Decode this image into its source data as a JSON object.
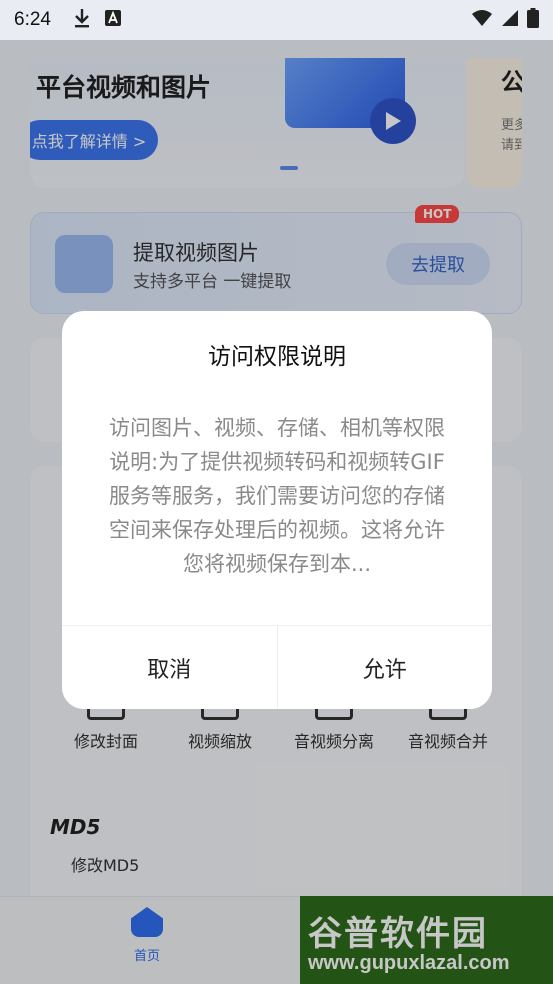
{
  "status_bar": {
    "time": "6:24"
  },
  "banner": {
    "title": "平台视频和图片",
    "button": "点我了解详情 >"
  },
  "side_card": {
    "title": "公",
    "text": "更多 请到"
  },
  "extract": {
    "title": "提取视频图片",
    "subtitle": "支持多平台 一键提取",
    "button": "去提取",
    "badge": "HOT"
  },
  "tools": [
    {
      "label": "修改封面"
    },
    {
      "label": "视频缩放"
    },
    {
      "label": "音视频分离"
    },
    {
      "label": "音视频合并"
    }
  ],
  "md5": {
    "icon_text": "MD5",
    "label": "修改MD5"
  },
  "bottom_nav": {
    "home_label": "首页"
  },
  "watermark": {
    "title": "谷普软件园",
    "url": "www.gupuxlazal.com"
  },
  "dialog": {
    "title": "访问权限说明",
    "body": "访问图片、视频、存储、相机等权限说明:为了提供视频转码和视频转GIF服务等服务，我们需要访问您的存储空间来保存处理后的视频。这将允许您将视频保存到本...",
    "cancel": "取消",
    "allow": "允许"
  }
}
